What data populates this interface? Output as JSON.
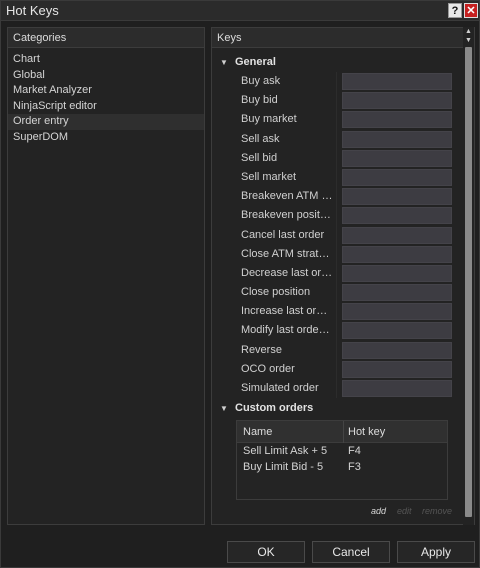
{
  "window": {
    "title": "Hot Keys",
    "help_glyph": "?",
    "close_glyph": "✕"
  },
  "categories": {
    "header": "Categories",
    "items": [
      "Chart",
      "Global",
      "Market Analyzer",
      "NinjaScript editor",
      "Order entry",
      "SuperDOM"
    ],
    "selected": "Order entry"
  },
  "keys": {
    "header": "Keys",
    "general_label": "General",
    "general_items": [
      "Buy ask",
      "Buy bid",
      "Buy market",
      "Sell ask",
      "Sell bid",
      "Sell market",
      "Breakeven ATM str...",
      "Breakeven position",
      "Cancel last order",
      "Close ATM strategy",
      "Decrease last ord...",
      "Close position",
      "Increase last orde...",
      "Modify last order to...",
      "Reverse",
      "OCO order",
      "Simulated order"
    ],
    "custom_label": "Custom orders",
    "custom_table": {
      "col_name": "Name",
      "col_hotkey": "Hot key",
      "rows": [
        {
          "name": "Sell Limit  Ask + 5",
          "hotkey": "F4"
        },
        {
          "name": "Buy Limit  Bid - 5",
          "hotkey": "F3"
        }
      ]
    },
    "links": {
      "add": "add",
      "edit": "edit",
      "remove": "remove"
    }
  },
  "scroll": {
    "up": "▲",
    "down": "▼"
  },
  "buttons": {
    "ok": "OK",
    "cancel": "Cancel",
    "apply": "Apply"
  },
  "colors": {
    "background": "#1e1e1e",
    "input": "#3d3c42",
    "close": "#c62020"
  }
}
